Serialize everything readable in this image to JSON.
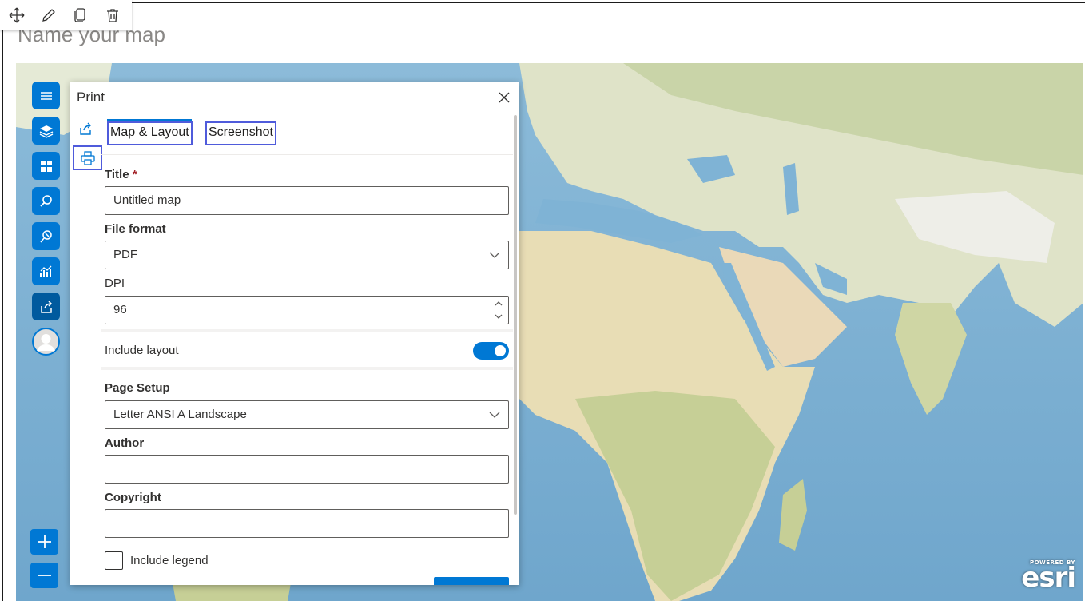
{
  "toolbar": {
    "move_icon": "move-icon",
    "edit_icon": "pencil-icon",
    "duplicate_icon": "copy-icon",
    "delete_icon": "trash-icon"
  },
  "page": {
    "title": "Name your map"
  },
  "map": {
    "attribution": {
      "powered": "POWERED BY",
      "word": "esri"
    }
  },
  "rail": {
    "items": [
      {
        "name": "menu",
        "icon": "hamburger-icon"
      },
      {
        "name": "layers",
        "icon": "layers-icon"
      },
      {
        "name": "basemap",
        "icon": "basemap-icon"
      },
      {
        "name": "search",
        "icon": "search-icon"
      },
      {
        "name": "locate",
        "icon": "location-icon"
      },
      {
        "name": "analysis",
        "icon": "chart-icon"
      },
      {
        "name": "share",
        "icon": "share-icon",
        "active": true
      },
      {
        "name": "profile",
        "icon": "avatar-icon"
      }
    ],
    "zoom_in": "+",
    "zoom_out": "−"
  },
  "panel": {
    "title": "Print",
    "tabs": [
      {
        "label": "Map & Layout",
        "selected": true
      },
      {
        "label": "Screenshot",
        "selected": false
      }
    ],
    "fields": {
      "title_label": "Title",
      "title_required": "*",
      "title_value": "Untitled map",
      "format_label": "File format",
      "format_value": "PDF",
      "dpi_label": "DPI",
      "dpi_value": "96",
      "include_layout_label": "Include layout",
      "include_layout_on": true,
      "page_setup_label": "Page Setup",
      "page_setup_value": "Letter ANSI A Landscape",
      "author_label": "Author",
      "author_value": "",
      "copyright_label": "Copyright",
      "copyright_value": "",
      "include_legend_label": "Include legend",
      "include_legend_checked": false
    }
  },
  "colors": {
    "accent": "#0078d4",
    "highlight": "#4f5bdb",
    "required": "#a4262c"
  }
}
